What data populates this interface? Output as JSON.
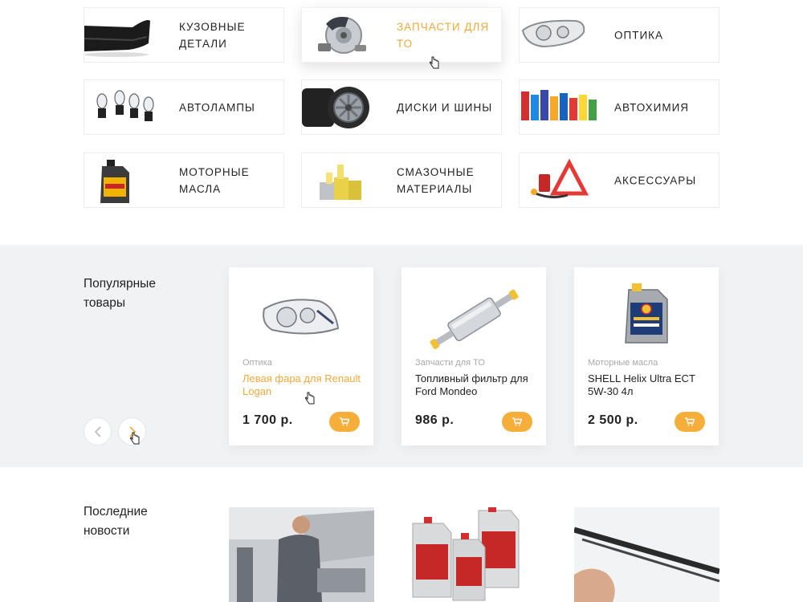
{
  "categories": [
    {
      "label": "КУЗОВНЫЕ ДЕТАЛИ",
      "icon": "bumper-icon"
    },
    {
      "label": "ЗАПЧАСТИ ДЛЯ ТО",
      "icon": "brake-disc-icon"
    },
    {
      "label": "ОПТИКА",
      "icon": "headlight-icon"
    },
    {
      "label": "АВТОЛАМПЫ",
      "icon": "bulbs-icon"
    },
    {
      "label": "ДИСКИ И ШИНЫ",
      "icon": "wheels-icon"
    },
    {
      "label": "АВТОХИМИЯ",
      "icon": "chemicals-icon"
    },
    {
      "label": "МОТОРНЫЕ МАСЛА",
      "icon": "oil-can-icon"
    },
    {
      "label": "СМАЗОЧНЫЕ МАТЕРИАЛЫ",
      "icon": "grease-icon"
    },
    {
      "label": "АКСЕССУАРЫ",
      "icon": "accessories-icon"
    }
  ],
  "popular": {
    "title": "Популярные товары",
    "products": [
      {
        "category": "Оптика",
        "name": "Левая фара для Renault Logan",
        "price": "1 700 р."
      },
      {
        "category": "Запчасти для ТО",
        "name": "Топливный фильтр для Ford Mondeo",
        "price": "986 р."
      },
      {
        "category": "Моторные масла",
        "name": "SHELL Helix Ultra ECT 5W-30 4л",
        "price": "2 500 р."
      }
    ]
  },
  "news": {
    "title": "Последние новости"
  },
  "colors": {
    "accent": "#f6ae3b",
    "section_bg": "#f1f2f4"
  }
}
